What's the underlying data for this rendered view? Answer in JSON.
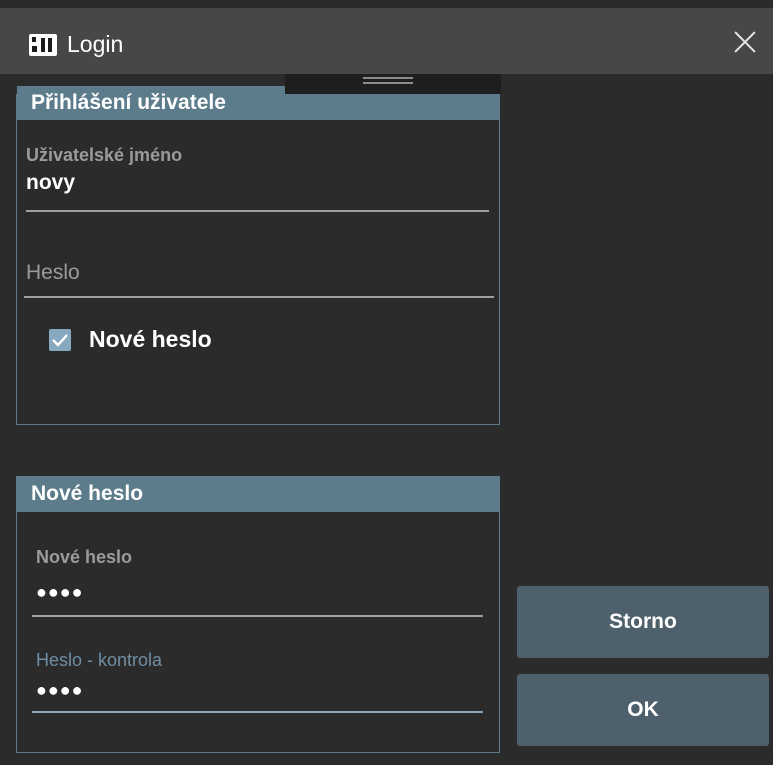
{
  "window": {
    "title": "Login",
    "icon": "app-logo-icon",
    "close_icon": "close-icon"
  },
  "login_panel": {
    "header": "Přihlášení uživatele",
    "username_label": "Uživatelské jméno",
    "username_value": "novy",
    "password_label": "Heslo",
    "new_password_checkbox_label": "Nové heslo",
    "new_password_checked": true
  },
  "new_password_panel": {
    "header": "Nové heslo",
    "new_password_label": "Nové heslo",
    "new_password_value": "●●●●",
    "confirm_label": "Heslo - kontrola",
    "confirm_value": "●●●●"
  },
  "buttons": {
    "cancel": "Storno",
    "ok": "OK"
  },
  "colors": {
    "accent": "#5c7c8c",
    "button": "#4e606b",
    "checkbox": "#86a8c0",
    "background": "#2b2b2b",
    "titlebar": "#474747"
  }
}
